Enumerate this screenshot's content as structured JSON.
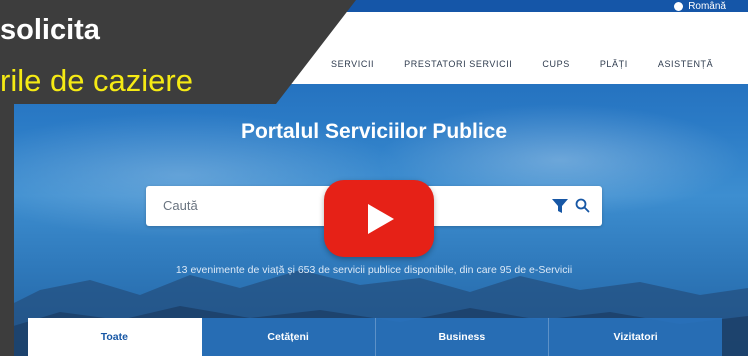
{
  "header": {
    "language": "Română",
    "nav_items": [
      "SERVICII",
      "PRESTATORI SERVICII",
      "CUPS",
      "PLĂȚI",
      "ASISTENȚĂ"
    ]
  },
  "hero": {
    "title": "Portalul Serviciilor Publice",
    "search_placeholder": "Caută",
    "stats_text": "13 evenimente de viață și 653 de servicii publice disponibile, din care 95 de e-Servicii"
  },
  "tabs": [
    "Toate",
    "Cetățeni",
    "Business",
    "Vizitatori"
  ],
  "overlay": {
    "line1": "solicita",
    "line2": "rile de caziere"
  },
  "colors": {
    "overlay_bg": "#3d3d3d",
    "overlay_highlight": "#f5ea14",
    "play_button": "#e62117",
    "accent_blue": "#1757a5"
  },
  "icons": [
    "globe-icon",
    "filter-icon",
    "search-icon",
    "play-icon"
  ]
}
